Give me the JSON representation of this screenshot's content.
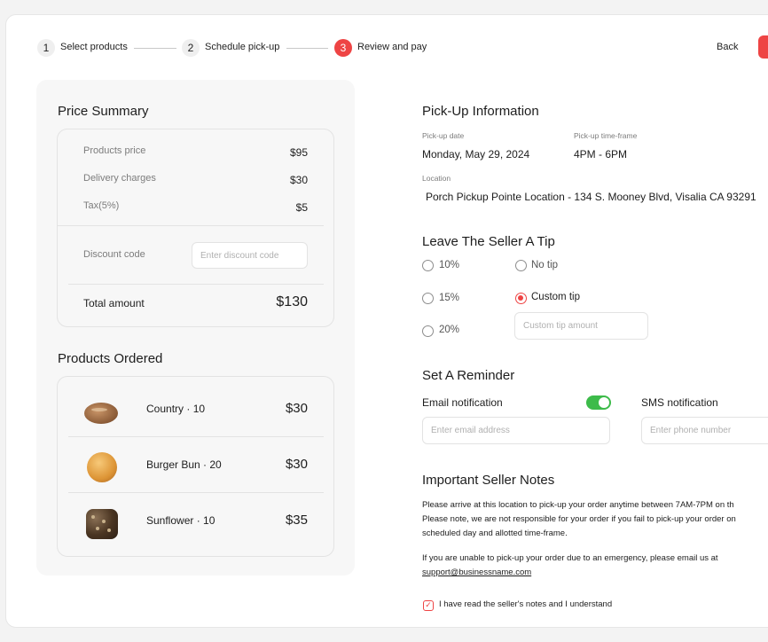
{
  "stepper": {
    "steps": [
      {
        "number": "1",
        "label": "Select products"
      },
      {
        "number": "2",
        "label": "Schedule pick-up"
      },
      {
        "number": "3",
        "label": "Review and pay"
      }
    ],
    "back_label": "Back"
  },
  "price_summary": {
    "title": "Price Summary",
    "rows": [
      {
        "label": "Products price",
        "value": "$95"
      },
      {
        "label": "Delivery charges",
        "value": "$30"
      },
      {
        "label": "Tax(5%)",
        "value": "$5"
      }
    ],
    "discount_label": "Discount code",
    "discount_placeholder": "Enter discount code",
    "total_label": "Total amount",
    "total_value": "$130"
  },
  "products": {
    "title": "Products Ordered",
    "items": [
      {
        "name": "Country",
        "qty": "10",
        "price": "$30",
        "image": "country-bread"
      },
      {
        "name": "Burger Bun",
        "qty": "20",
        "price": "$30",
        "image": "burger-bun"
      },
      {
        "name": "Sunflower",
        "qty": "10",
        "price": "$35",
        "image": "sunflower-bread"
      }
    ]
  },
  "pickup": {
    "title": "Pick-Up Information",
    "date_label": "Pick-up date",
    "date_value": "Monday, May 29, 2024",
    "timeframe_label": "Pick-up time-frame",
    "timeframe_value": "4PM - 6PM",
    "location_label": "Location",
    "location_value": "Porch Pickup Pointe Location - 134 S. Mooney Blvd, Visalia CA 93291"
  },
  "tip": {
    "title": "Leave The Seller A Tip",
    "options": [
      "10%",
      "15%",
      "20%"
    ],
    "no_tip_label": "No tip",
    "custom_tip_label": "Custom tip",
    "custom_tip_placeholder": "Custom tip amount",
    "selected": "Custom tip"
  },
  "reminder": {
    "title": "Set A Reminder",
    "email_label": "Email notification",
    "email_enabled": true,
    "email_placeholder": "Enter email address",
    "sms_label": "SMS notification",
    "sms_placeholder": "Enter phone number"
  },
  "notes": {
    "title": "Important Seller Notes",
    "line1": "Please arrive at this location to pick-up your order anytime between 7AM-7PM on th",
    "line2": "Please note, we are not responsible for your order if you fail to pick-up your order on",
    "line3": "scheduled day and allotted time-frame.",
    "line4": "If you are unable to pick-up your order due to an emergency, please email us at",
    "email": "support@businessname.com",
    "agree_label": "I have read the seller's notes and I understand",
    "agree_checked": true
  },
  "colors": {
    "accent": "#ee4444",
    "toggle_on": "#3dbb4a"
  }
}
